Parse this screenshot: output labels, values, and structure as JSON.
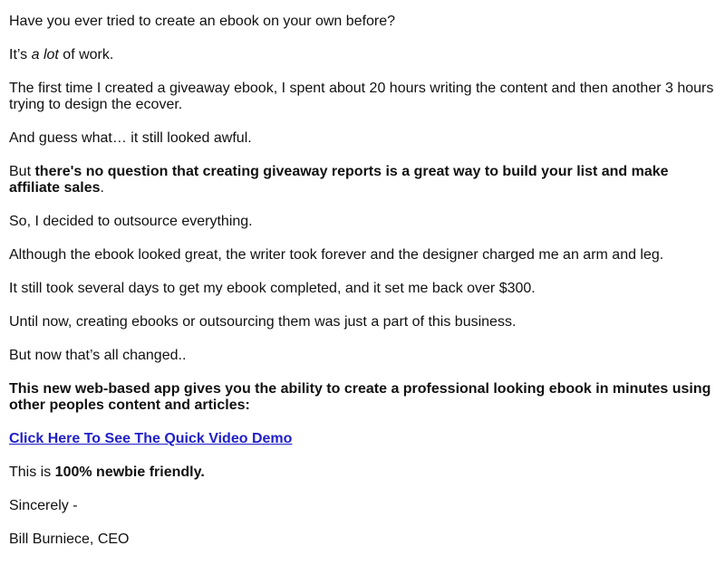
{
  "email": {
    "p1": "Have you ever tried to create an ebook on your own before?",
    "p2_pre": "It’s ",
    "p2_em": "a lot",
    "p2_post": " of work.",
    "p3": "The first time I created a giveaway ebook, I spent about 20 hours writing the content and then another 3 hours trying to design the ecover.",
    "p4": "And guess what… it still looked awful.",
    "p5_pre": "But ",
    "p5_bold": "there's no question that creating giveaway reports is a great way to build your list and make affiliate sales",
    "p5_post": ".",
    "p6": "So, I decided to outsource everything.",
    "p7": "Although the ebook looked great, the writer took forever and the designer charged me an arm and leg.",
    "p8": "It still took several days to get my ebook completed, and it set me back over $300.",
    "p9": "Until now, creating ebooks or outsourcing them was just a part of this business.",
    "p10": "But now that’s all changed..",
    "p11_bold": "This new web-based app gives you the ability to create a professional looking ebook in minutes using other peoples content and articles:",
    "link_label": "Click Here To See The Quick Video Demo",
    "p12_pre": "This is ",
    "p12_bold": "100% newbie friendly.",
    "closing": "Sincerely -",
    "signature": "Bill Burniece, CEO"
  },
  "colors": {
    "text": "#111111",
    "link": "#2020c8",
    "background": "#ffffff"
  }
}
